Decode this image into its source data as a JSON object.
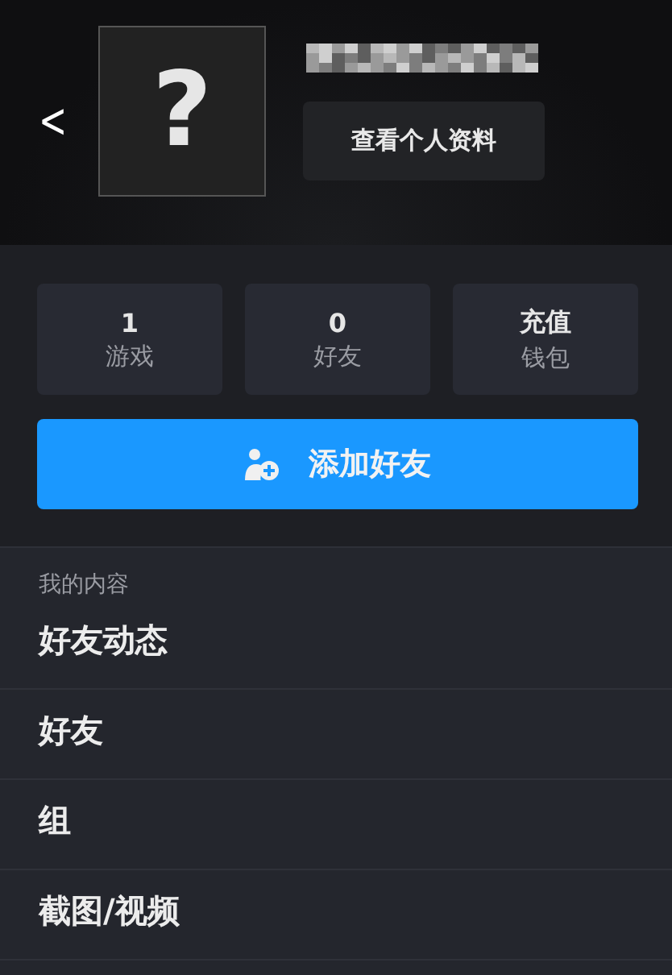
{
  "header": {
    "back": "<",
    "avatar": "?",
    "profile_button": "查看个人资料"
  },
  "stats": [
    {
      "value": "1",
      "label": "游戏"
    },
    {
      "value": "0",
      "label": "好友"
    },
    {
      "value": "充值",
      "label": "钱包"
    }
  ],
  "add_friend_button": "添加好友",
  "content": {
    "heading": "我的内容",
    "items": [
      "好友动态",
      "好友",
      "组",
      "截图/视频"
    ]
  }
}
